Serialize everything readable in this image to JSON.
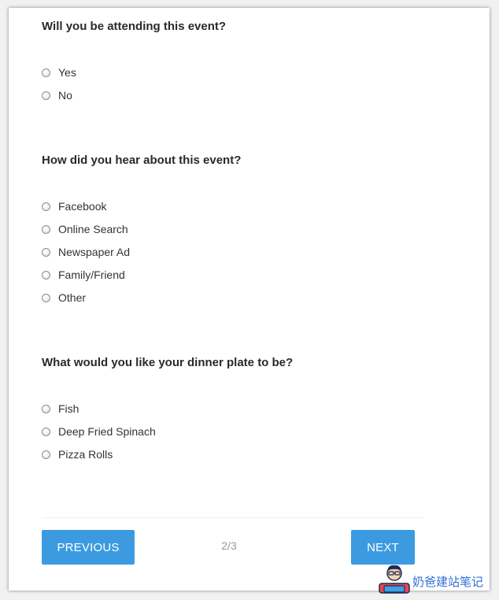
{
  "questions": [
    {
      "text": "Will you be attending this event?",
      "options": [
        "Yes",
        "No"
      ]
    },
    {
      "text": "How did you hear about this event?",
      "options": [
        "Facebook",
        "Online Search",
        "Newspaper Ad",
        "Family/Friend",
        "Other"
      ]
    },
    {
      "text": "What would you like your dinner plate to be?",
      "options": [
        "Fish",
        "Deep Fried Spinach",
        "Pizza Rolls"
      ]
    }
  ],
  "navigation": {
    "previous_label": "PREVIOUS",
    "next_label": "NEXT",
    "page_indicator": "2/3"
  },
  "watermark": {
    "text": "奶爸建站笔记"
  },
  "colors": {
    "button": "#3c9be0",
    "watermark_text": "#2f6fd6"
  }
}
